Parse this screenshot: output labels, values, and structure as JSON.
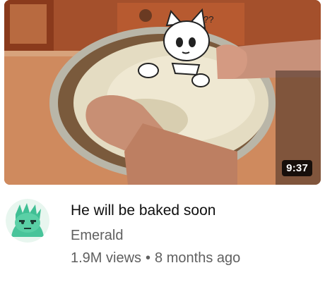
{
  "video": {
    "duration": "9:37",
    "title": "He will be baked soon",
    "channel": "Emerald",
    "views": "1.9M views",
    "separator": "•",
    "age": "8 months ago"
  },
  "overlay": {
    "question_marks": "??"
  },
  "icons": {
    "avatar": "green-cartoon-character-avatar"
  }
}
